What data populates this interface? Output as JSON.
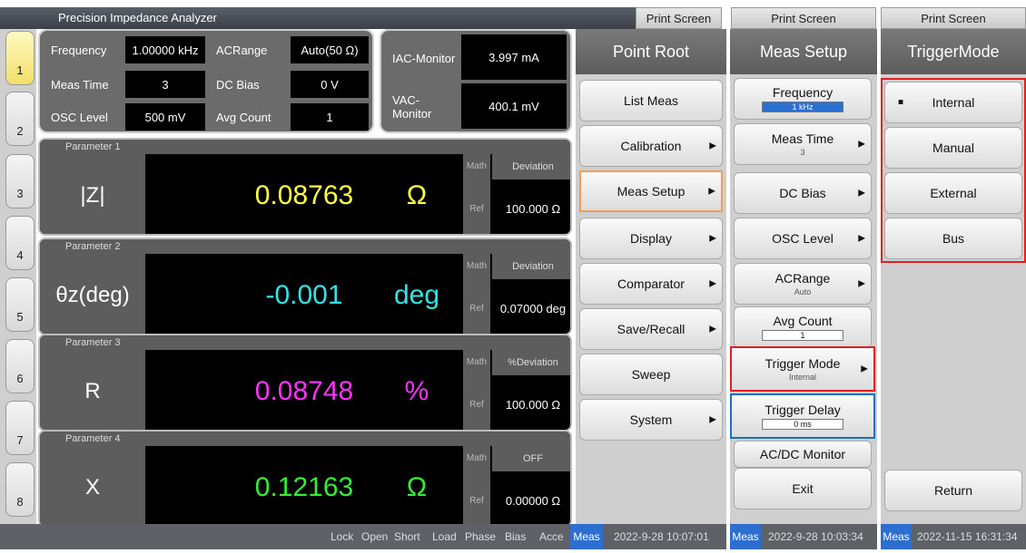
{
  "title": "Precision Impedance Analyzer",
  "print_screen": "Print Screen",
  "tabs": [
    "1",
    "2",
    "3",
    "4",
    "5",
    "6",
    "7",
    "8"
  ],
  "header": {
    "freq_label": "Frequency",
    "freq_value": "1.00000 kHz",
    "acrange_label": "ACRange",
    "acrange_value": "Auto(50 Ω)",
    "meastime_label": "Meas Time",
    "meastime_value": "3",
    "dcbias_label": "DC Bias",
    "dcbias_value": "0 V",
    "osc_label": "OSC Level",
    "osc_value": "500 mV",
    "avg_label": "Avg Count",
    "avg_value": "1"
  },
  "monitor": {
    "iac_label": "IAC-Monitor",
    "iac_value": "3.997 mA",
    "vac_label": "VAC-Monitor",
    "vac_value": "400.1 mV"
  },
  "params": [
    {
      "title": "Parameter 1",
      "name": "|Z|",
      "value": "0.08763",
      "unit": "Ω",
      "math_label": "Math",
      "ref_label": "Ref",
      "math": "Deviation",
      "ref": "100.000 Ω",
      "color": "#ffff44"
    },
    {
      "title": "Parameter 2",
      "name": "θz(deg)",
      "value": "-0.001",
      "unit": "deg",
      "math_label": "Math",
      "ref_label": "Ref",
      "math": "Deviation",
      "ref": "0.07000 deg",
      "color": "#33e3e3"
    },
    {
      "title": "Parameter 3",
      "name": "R",
      "value": "0.08748",
      "unit": "%",
      "math_label": "Math",
      "ref_label": "Ref",
      "math": "%Deviation",
      "ref": "100.000 Ω",
      "color": "#ff33ff"
    },
    {
      "title": "Parameter 4",
      "name": "X",
      "value": "0.12163",
      "unit": "Ω",
      "math_label": "Math",
      "ref_label": "Ref",
      "math": "OFF",
      "ref": "0.00000 Ω",
      "color": "#33ee33"
    }
  ],
  "menu1": {
    "title": "Point Root",
    "items": [
      "List Meas",
      "Calibration",
      "Meas Setup",
      "Display",
      "Comparator",
      "Save/Recall",
      "Sweep",
      "System"
    ]
  },
  "menu2": {
    "title": "Meas Setup",
    "frequency": "Frequency",
    "frequency_value": "1 kHz",
    "meastime": "Meas Time",
    "meastime_value": "3",
    "dcbias": "DC Bias",
    "osc": "OSC Level",
    "acrange": "ACRange",
    "acrange_value": "Auto",
    "avgcount": "Avg Count",
    "avgcount_value": "1",
    "trigmode": "Trigger Mode",
    "trigmode_value": "Internal",
    "trigdelay": "Trigger Delay",
    "trigdelay_value": "0 ms",
    "acdc": "AC/DC Monitor",
    "exit": "Exit"
  },
  "menu3": {
    "title": "TriggerMode",
    "items": [
      "Internal",
      "Manual",
      "External",
      "Bus"
    ],
    "return": "Return",
    "bullet": "■"
  },
  "status": {
    "items": [
      "Lock",
      "Open",
      "Short",
      "Load",
      "Phase",
      "Bias",
      "Acce"
    ],
    "meas": "Meas",
    "time1": "2022-9-28 10:07:01",
    "time2": "2022-9-28 10:03:34",
    "time3": "2022-11-15 16:31:34"
  },
  "colors": {
    "highlight_orange": "#f0a050",
    "highlight_red": "#e02020",
    "highlight_blue": "#1a6fc4"
  }
}
